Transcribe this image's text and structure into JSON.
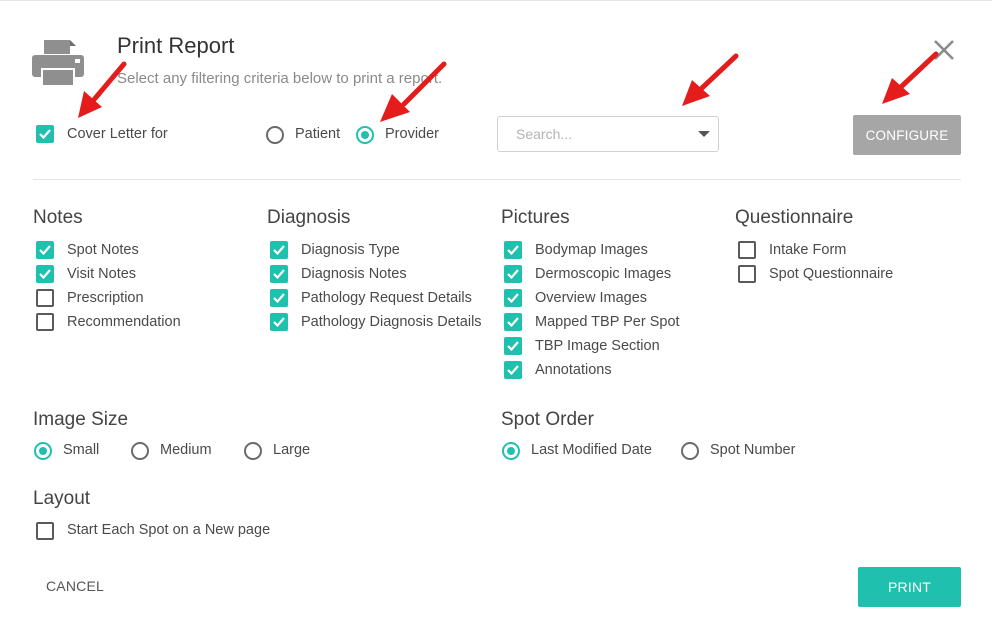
{
  "header": {
    "title": "Print Report",
    "subtitle": "Select any filtering criteria below to print a report.",
    "icon": "printer-icon"
  },
  "filter": {
    "cover_letter_label": "Cover Letter for",
    "cover_letter_checked": true,
    "options": [
      {
        "label": "Patient",
        "selected": false
      },
      {
        "label": "Provider",
        "selected": true
      }
    ],
    "search_placeholder": "Search...",
    "configure_label": "CONFIGURE"
  },
  "sections": {
    "notes": {
      "title": "Notes",
      "items": [
        {
          "label": "Spot Notes",
          "checked": true
        },
        {
          "label": "Visit Notes",
          "checked": true
        },
        {
          "label": "Prescription",
          "checked": false
        },
        {
          "label": "Recommendation",
          "checked": false
        }
      ]
    },
    "diagnosis": {
      "title": "Diagnosis",
      "items": [
        {
          "label": "Diagnosis Type",
          "checked": true
        },
        {
          "label": "Diagnosis Notes",
          "checked": true
        },
        {
          "label": "Pathology Request Details",
          "checked": true
        },
        {
          "label": "Pathology Diagnosis Details",
          "checked": true
        }
      ]
    },
    "pictures": {
      "title": "Pictures",
      "items": [
        {
          "label": "Bodymap Images",
          "checked": true
        },
        {
          "label": "Dermoscopic Images",
          "checked": true
        },
        {
          "label": "Overview Images",
          "checked": true
        },
        {
          "label": "Mapped TBP Per Spot",
          "checked": true
        },
        {
          "label": "TBP Image Section",
          "checked": true
        },
        {
          "label": "Annotations",
          "checked": true
        }
      ]
    },
    "questionnaire": {
      "title": "Questionnaire",
      "items": [
        {
          "label": "Intake Form",
          "checked": false
        },
        {
          "label": "Spot Questionnaire",
          "checked": false
        }
      ]
    }
  },
  "image_size": {
    "title": "Image Size",
    "options": [
      {
        "label": "Small",
        "selected": true
      },
      {
        "label": "Medium",
        "selected": false
      },
      {
        "label": "Large",
        "selected": false
      }
    ]
  },
  "spot_order": {
    "title": "Spot Order",
    "options": [
      {
        "label": "Last Modified Date",
        "selected": true
      },
      {
        "label": "Spot Number",
        "selected": false
      }
    ]
  },
  "layout": {
    "title": "Layout",
    "items": [
      {
        "label": "Start Each Spot on a New page",
        "checked": false
      }
    ]
  },
  "footer": {
    "cancel_label": "CANCEL",
    "print_label": "PRINT"
  },
  "colors": {
    "accent": "#1fc0ad",
    "disabled_button": "#a6a6a6",
    "annotation_arrow": "#e51c1c"
  }
}
